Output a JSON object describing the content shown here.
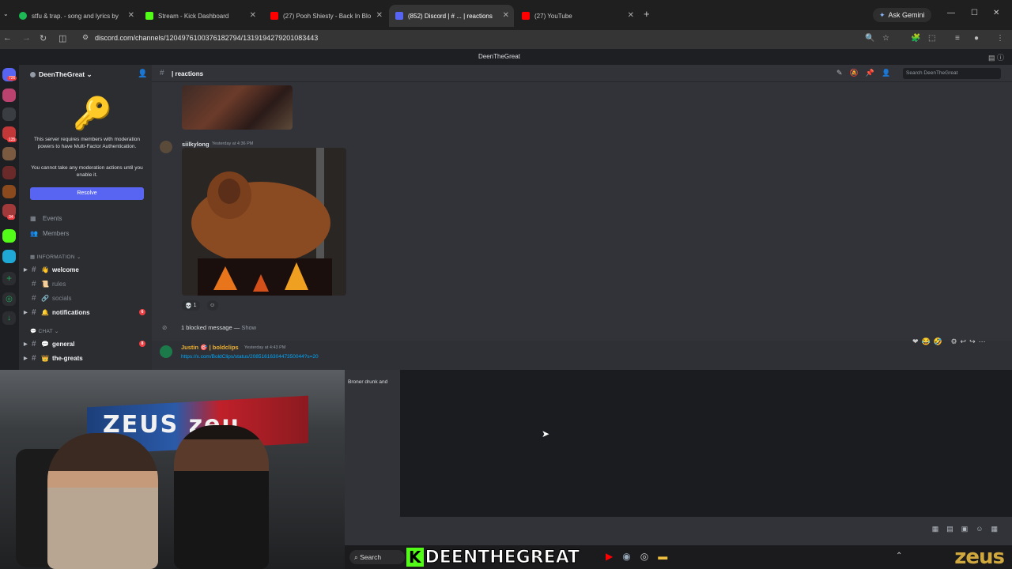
{
  "browser": {
    "tabs": [
      {
        "title": "stfu & trap. - song and lyrics by",
        "favicon_color": "#1db954",
        "active": false
      },
      {
        "title": "Stream - Kick Dashboard",
        "favicon_color": "#53fc18",
        "active": false
      },
      {
        "title": "(27) Pooh Shiesty - Back In Blo",
        "favicon_color": "#ff0000",
        "active": false
      },
      {
        "title": "(852) Discord | # ... | reactions",
        "favicon_color": "#5865f2",
        "active": true
      },
      {
        "title": "(27) YouTube",
        "favicon_color": "#ff0000",
        "active": false
      }
    ],
    "new_tab": "+",
    "ask_gemini": "Ask Gemini",
    "url": "discord.com/channels/1204976100376182794/1319194279201083443"
  },
  "discord": {
    "window_title": "DeenTheGreat",
    "rail_badges": [
      "726",
      "135",
      "34"
    ],
    "guild_name": "DeenTheGreat",
    "mfa": {
      "line1": "This server requires members with moderation powers to have Multi-Factor Authentication.",
      "line2": "You cannot take any moderation actions until you enable it.",
      "button": "Resolve"
    },
    "nav": [
      {
        "label": "Events",
        "icon": "calendar-icon"
      },
      {
        "label": "Members",
        "icon": "members-icon"
      }
    ],
    "categories": {
      "information": "INFORMATION",
      "chat": "CHAT"
    },
    "channels_info": [
      {
        "name": "welcome",
        "emoji": "👋",
        "unread": true,
        "ping": ""
      },
      {
        "name": "rules",
        "emoji": "📜",
        "unread": false,
        "ping": ""
      },
      {
        "name": "socials",
        "emoji": "🔗",
        "unread": false,
        "ping": ""
      },
      {
        "name": "notifications",
        "emoji": "🔔",
        "unread": true,
        "ping": "6"
      }
    ],
    "channels_chat": [
      {
        "name": "general",
        "emoji": "💬",
        "unread": true,
        "ping": "8"
      },
      {
        "name": "the-greats",
        "emoji": "👑",
        "unread": true,
        "ping": ""
      }
    ],
    "channel": {
      "name": "| reactions",
      "search_placeholder": "Search DeenTheGreat"
    },
    "messages": {
      "msg1": {
        "author": "siilkylong",
        "author_color": "#f0b232",
        "time": "Yesterday at 4:36 PM",
        "reaction_count": "1"
      },
      "blocked": {
        "text": "1 blocked message —",
        "show": "Show"
      },
      "msg2": {
        "author": "Justin 🎯 | boldclips",
        "author_color": "#f0b232",
        "time": "Yesterday at 4:43 PM",
        "link": "https://x.com/BoldClips/status/2085161630447350044?s=20"
      },
      "embed_snippet": "Broner drunk and"
    }
  },
  "webcam": {
    "sign_text": "ZEUS zeu",
    "chair_label": "zeus"
  },
  "taskbar": {
    "search_label": "Search",
    "banner_k": "K",
    "banner_text": "DEENTHEGREAT",
    "logo": "zeus"
  }
}
